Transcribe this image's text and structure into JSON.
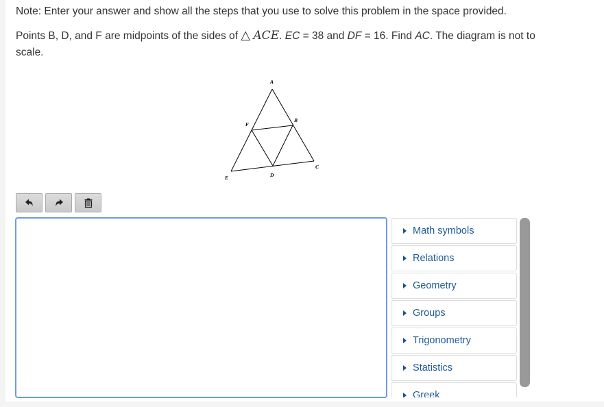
{
  "note": "Note: Enter your answer and show all the steps that you use to solve this problem in the space provided.",
  "problem": {
    "part1": "Points B, D, and F are midpoints of the sides of ",
    "triangle_symbol": "△",
    "triangle_name": "ACE",
    "part2": ". ",
    "ec_label": "EC",
    "ec_value": " = 38 and ",
    "df_label": "DF",
    "df_value": " = 16. Find ",
    "ac_label": "AC",
    "part3": ". The diagram is not to scale."
  },
  "diagram": {
    "labels": {
      "A": "A",
      "B": "B",
      "C": "C",
      "D": "D",
      "E": "E",
      "F": "F"
    }
  },
  "toolbar": {
    "undo_icon": "undo-arrow",
    "redo_icon": "redo-arrow",
    "delete_icon": "trash-can"
  },
  "editor": {
    "value": ""
  },
  "palette": {
    "items": [
      {
        "label": "Math symbols"
      },
      {
        "label": "Relations"
      },
      {
        "label": "Geometry"
      },
      {
        "label": "Groups"
      },
      {
        "label": "Trigonometry"
      },
      {
        "label": "Statistics"
      },
      {
        "label": "Greek"
      }
    ]
  },
  "colors": {
    "editor_border": "#6d9be0",
    "palette_text": "#1f5a98",
    "scrollbar": "#999999"
  }
}
